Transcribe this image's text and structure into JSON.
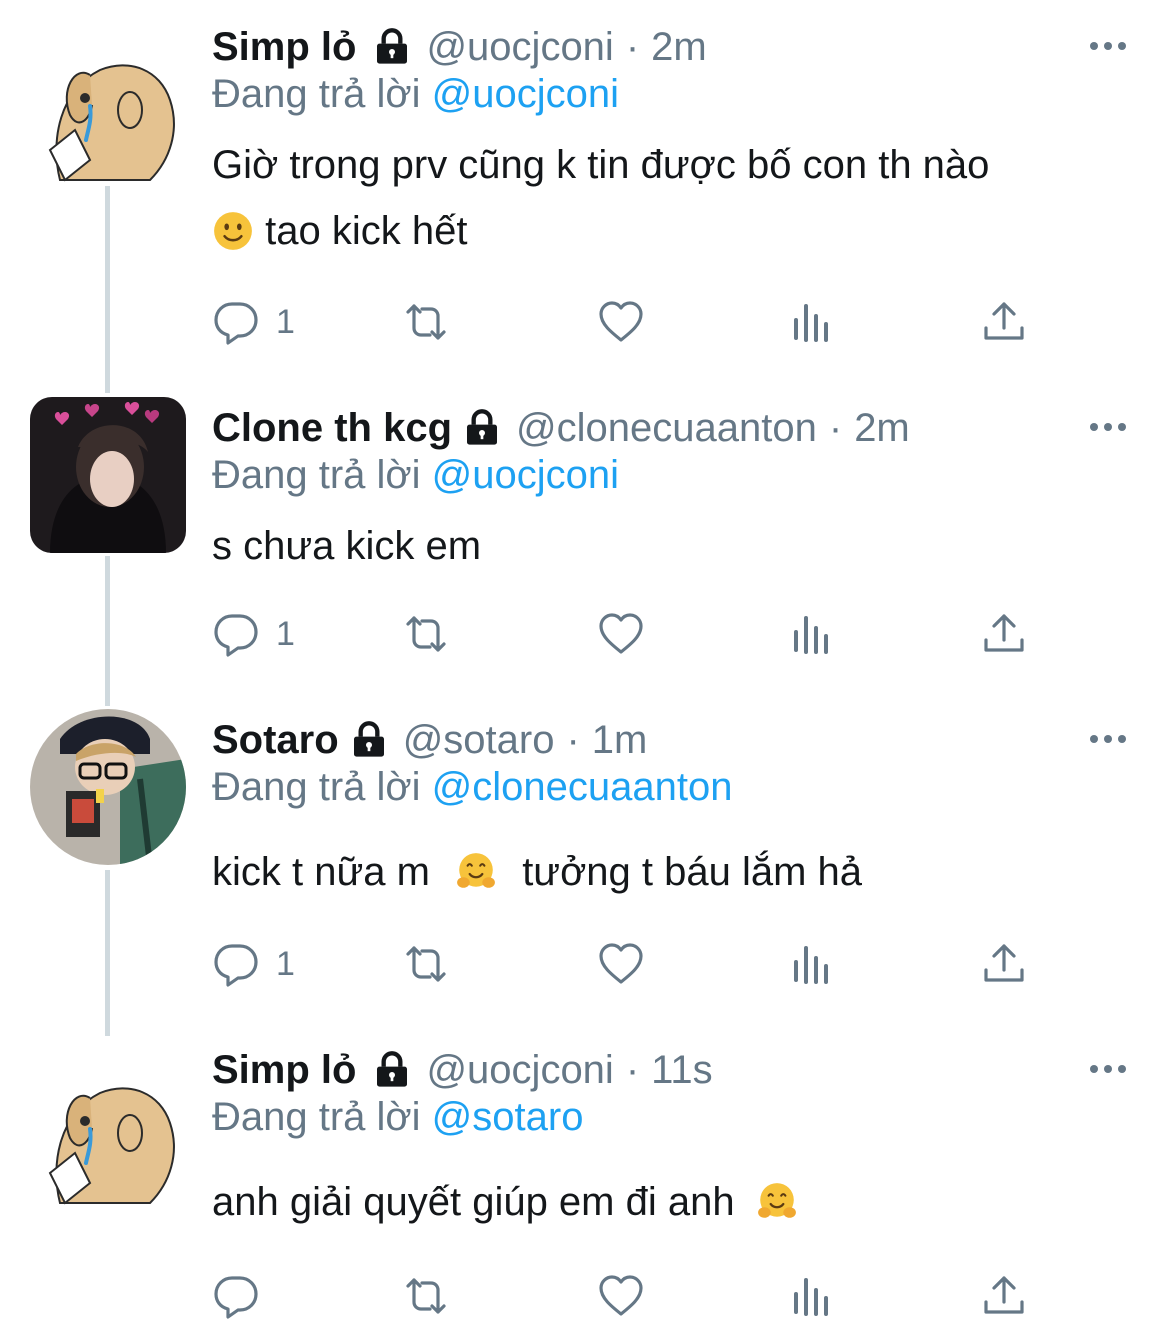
{
  "reply_prefix": "Đang trả lời",
  "tweets": [
    {
      "name": "Simp lỏ",
      "handle": "@uocjconi",
      "time": "2m",
      "reply_to": "@uocjconi",
      "text_line1": "Giờ trong prv cũng k tin được bố con th nào",
      "text_line2": "tao kick hết",
      "reply_count": "1"
    },
    {
      "name": "Clone th kcg",
      "handle": "@clonecuaanton",
      "time": "2m",
      "reply_to": "@uocjconi",
      "text_line1": "s chưa kick em",
      "reply_count": "1"
    },
    {
      "name": "Sotaro",
      "handle": "@sotaro",
      "time": "1m",
      "reply_to": "@clonecuaanton",
      "text_part1": "kick t nữa m",
      "text_part2": "tưởng t báu lắm hả",
      "reply_count": "1"
    },
    {
      "name": "Simp lỏ",
      "handle": "@uocjconi",
      "time": "11s",
      "reply_to": "@sotaro",
      "text_line1": "anh giải quyết giúp em đi anh",
      "reply_count": ""
    }
  ],
  "colors": {
    "accent": "#1da1f2",
    "secondary_text": "#657786",
    "thread_line": "#cfd9de"
  },
  "icons": [
    "lock-icon",
    "more-icon",
    "reply-icon",
    "retweet-icon",
    "like-icon",
    "analytics-icon",
    "share-icon",
    "slightly-smiling-emoji",
    "hugging-emoji"
  ]
}
